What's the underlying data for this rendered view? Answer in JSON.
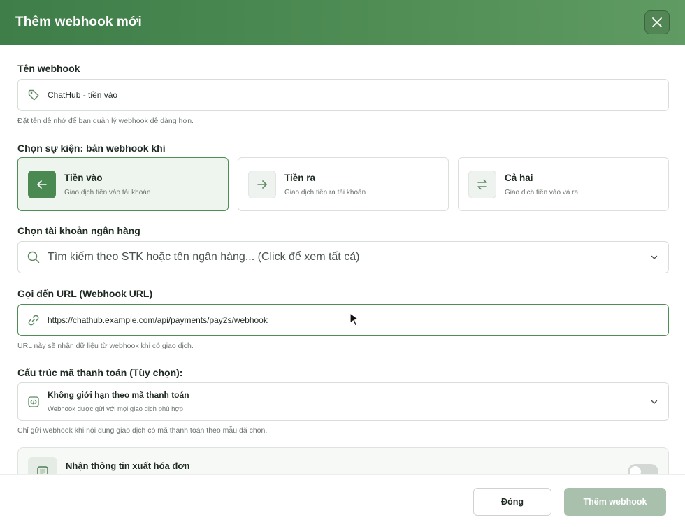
{
  "header": {
    "title": "Thêm webhook mới"
  },
  "name_field": {
    "label": "Tên webhook",
    "value": "ChatHub - tiền vào",
    "help": "Đặt tên dễ nhớ để bạn quản lý webhook dễ dàng hơn."
  },
  "events": {
    "label": "Chọn sự kiện: bản webhook khi",
    "options": [
      {
        "title": "Tiền vào",
        "desc": "Giao dịch tiền vào tài khoản",
        "icon": "arrow-left-icon",
        "selected": true
      },
      {
        "title": "Tiền ra",
        "desc": "Giao dịch tiền ra tài khoản",
        "icon": "arrow-right-icon",
        "selected": false
      },
      {
        "title": "Cả hai",
        "desc": "Giao dịch tiền vào và ra",
        "icon": "arrows-swap-icon",
        "selected": false
      }
    ]
  },
  "bank": {
    "label": "Chọn tài khoản ngân hàng",
    "placeholder": "Tìm kiếm theo STK hoặc tên ngân hàng... (Click để xem tất cả)"
  },
  "url_field": {
    "label": "Gọi đến URL (Webhook URL)",
    "value": "https://chathub.example.com/api/payments/pay2s/webhook",
    "help": "URL này sẽ nhận dữ liệu từ webhook khi có giao dịch."
  },
  "payment_code": {
    "label": "Cấu trúc mã thanh toán (Tùy chọn):",
    "selected_title": "Không giới hạn theo mã thanh toán",
    "selected_desc": "Webhook được gửi với mọi giao dịch phù hợp",
    "help": "Chỉ gửi webhook khi nội dung giao dịch có mã thanh toán theo mẫu đã chọn."
  },
  "invoice": {
    "title": "Nhận thông tin xuất hóa đơn",
    "enabled": false
  },
  "footer": {
    "close_label": "Đóng",
    "add_label": "Thêm webhook"
  },
  "colors": {
    "brand": "#4f8d55",
    "brand_dark": "#3f7d49",
    "add_disabled": "#a9c0ad"
  }
}
